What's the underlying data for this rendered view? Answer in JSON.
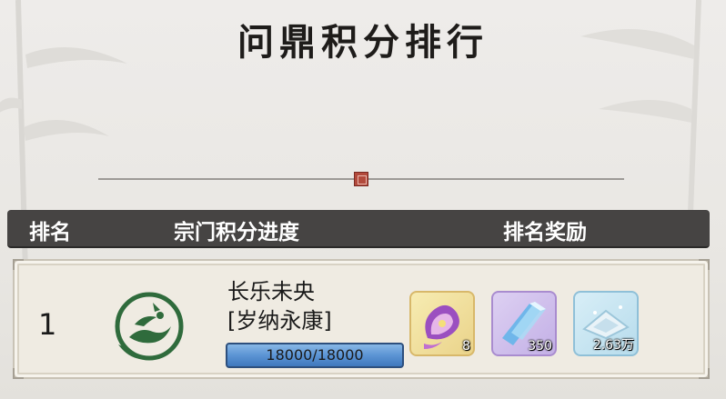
{
  "title": "问鼎积分排行",
  "header": {
    "rank_label": "排名",
    "progress_label": "宗门积分进度",
    "reward_label": "排名奖励"
  },
  "rows": [
    {
      "rank": "1",
      "sect_name": "长乐未央",
      "sect_sub": "[岁纳永康]",
      "progress_text": "18000/18000",
      "progress_fraction": 1.0,
      "rewards": [
        {
          "icon": "purple-flower-spirit-icon",
          "count": "8"
        },
        {
          "icon": "blue-crystal-icon",
          "count": "350"
        },
        {
          "icon": "silver-ingot-icon",
          "count": "2.63万"
        }
      ]
    }
  ],
  "colors": {
    "header_bg": "#464443",
    "progress_fill": "#5b94d4",
    "seal_red": "#b24a3c"
  }
}
